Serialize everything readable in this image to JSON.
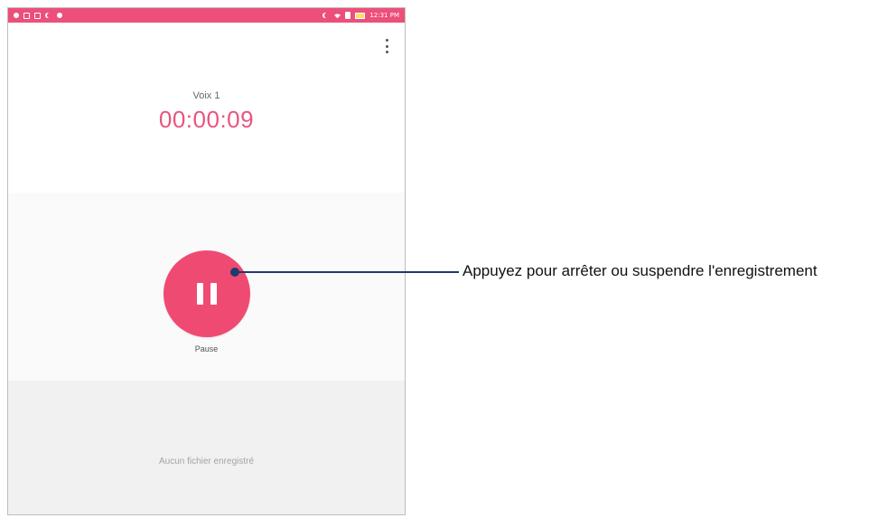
{
  "status_bar": {
    "time": "12:31 PM",
    "left_icons": [
      "notification-icon",
      "message-icon",
      "screenshot-icon",
      "moon-icon",
      "android-icon"
    ],
    "right_icons": [
      "moon-icon",
      "wifi-icon",
      "sim-icon",
      "battery-icon"
    ],
    "color": "#ec4f7b"
  },
  "recorder": {
    "recording_name": "Voix 1",
    "timer": "00:00:09",
    "accent_color": "#ef4b72"
  },
  "controls": {
    "pause_label": "Pause"
  },
  "file_list": {
    "empty_text": "Aucun fichier enregistré"
  },
  "annotation": {
    "text": "Appuyez pour arrêter ou suspendre l'enregistrement",
    "color": "#1f3a6e"
  }
}
